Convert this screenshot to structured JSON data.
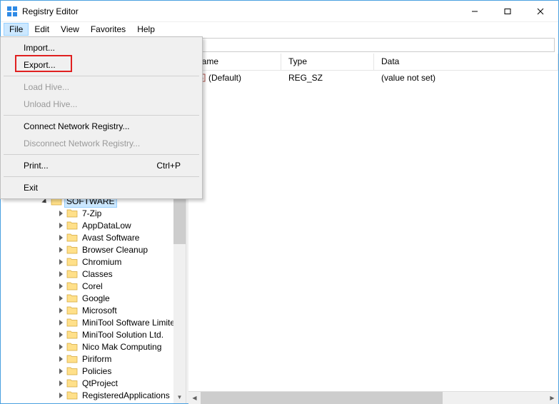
{
  "window": {
    "title": "Registry Editor",
    "min_tip": "Minimize",
    "max_tip": "Maximize",
    "close_tip": "Close"
  },
  "menubar": [
    "File",
    "Edit",
    "View",
    "Favorites",
    "Help"
  ],
  "file_menu": {
    "import": "Import...",
    "export": "Export...",
    "load_hive": "Load Hive...",
    "unload_hive": "Unload Hive...",
    "connect": "Connect Network Registry...",
    "disconnect": "Disconnect Network Registry...",
    "print": "Print...",
    "print_shortcut": "Ctrl+P",
    "exit": "Exit"
  },
  "address": "",
  "list": {
    "columns": {
      "name": "Name",
      "type": "Type",
      "data": "Data"
    },
    "rows": [
      {
        "name": "(Default)",
        "type": "REG_SZ",
        "data": "(value not set)"
      }
    ]
  },
  "tree": {
    "selected": "SOFTWARE",
    "items": [
      {
        "label": "SOFTWARE",
        "level": 3,
        "expanded": true,
        "selected": true
      },
      {
        "label": "7-Zip",
        "level": 4,
        "expanded": false
      },
      {
        "label": "AppDataLow",
        "level": 4,
        "expanded": false
      },
      {
        "label": "Avast Software",
        "level": 4,
        "expanded": false
      },
      {
        "label": "Browser Cleanup",
        "level": 4,
        "expanded": false
      },
      {
        "label": "Chromium",
        "level": 4,
        "expanded": false
      },
      {
        "label": "Classes",
        "level": 4,
        "expanded": false
      },
      {
        "label": "Corel",
        "level": 4,
        "expanded": false
      },
      {
        "label": "Google",
        "level": 4,
        "expanded": false
      },
      {
        "label": "Microsoft",
        "level": 4,
        "expanded": false
      },
      {
        "label": "MiniTool Software Limited",
        "level": 4,
        "expanded": false
      },
      {
        "label": "MiniTool Solution Ltd.",
        "level": 4,
        "expanded": false
      },
      {
        "label": "Nico Mak Computing",
        "level": 4,
        "expanded": false
      },
      {
        "label": "Piriform",
        "level": 4,
        "expanded": false
      },
      {
        "label": "Policies",
        "level": 4,
        "expanded": false
      },
      {
        "label": "QtProject",
        "level": 4,
        "expanded": false
      },
      {
        "label": "RegisteredApplications",
        "level": 4,
        "expanded": false
      }
    ]
  }
}
